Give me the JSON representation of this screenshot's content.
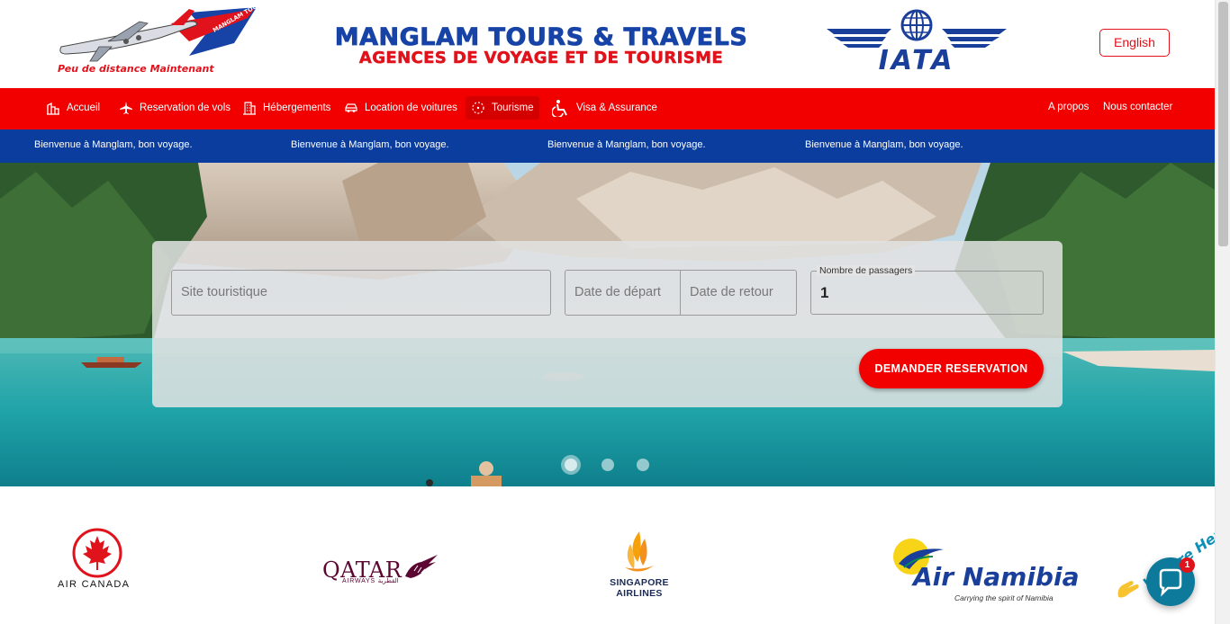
{
  "header": {
    "logo_tagline": "Peu de distance Maintenant",
    "logo_badge": "MANGLAM TOURS & TRAVELS",
    "brand_title": "MANGLAM TOURS & TRAVELS",
    "brand_subtitle": "AGENCES DE VOYAGE ET DE TOURISME",
    "iata_label": "IATA",
    "language_button": "English"
  },
  "nav": {
    "items": [
      {
        "label": "Accueil",
        "icon": "city-icon"
      },
      {
        "label": "Reservation de vols",
        "icon": "airplane-icon"
      },
      {
        "label": "Hébergements",
        "icon": "building-icon"
      },
      {
        "label": "Location de voitures",
        "icon": "car-icon"
      },
      {
        "label": "Tourisme",
        "icon": "compass-icon",
        "active": true
      },
      {
        "label": "Visa & Assurance",
        "icon": "accessible-icon"
      }
    ],
    "right": [
      "A propos",
      "Nous contacter"
    ]
  },
  "ticker": {
    "messages": [
      "Bienvenue à Manglam, bon voyage.",
      "Bienvenue à Manglam, bon voyage.",
      "Bienvenue à Manglam, bon voyage.",
      "Bienvenue à Manglam, bon voyage."
    ]
  },
  "search": {
    "site_placeholder": "Site touristique",
    "departure_placeholder": "Date de départ",
    "return_placeholder": "Date de retour",
    "passengers_label": "Nombre de passagers",
    "passengers_value": "1",
    "submit_label": "DEMANDER RESERVATION"
  },
  "carousel": {
    "slide_count": 3,
    "active_slide": 1
  },
  "partners": {
    "air_canada": "AIR CANADA",
    "qatar": "QATAR",
    "qatar_sub": "AIRWAYS القطرية",
    "singapore_line1": "SINGAPORE",
    "singapore_line2": "AIRLINES",
    "air_namibia": "Air Namibia",
    "air_namibia_tagline": "Carrying the spirit of Namibia"
  },
  "chat": {
    "banner": "We Are Here!",
    "badge_count": "1"
  },
  "colors": {
    "brand_red": "#f20000",
    "brand_blue": "#0a3d9e",
    "chat_teal": "#0d7a9b"
  }
}
